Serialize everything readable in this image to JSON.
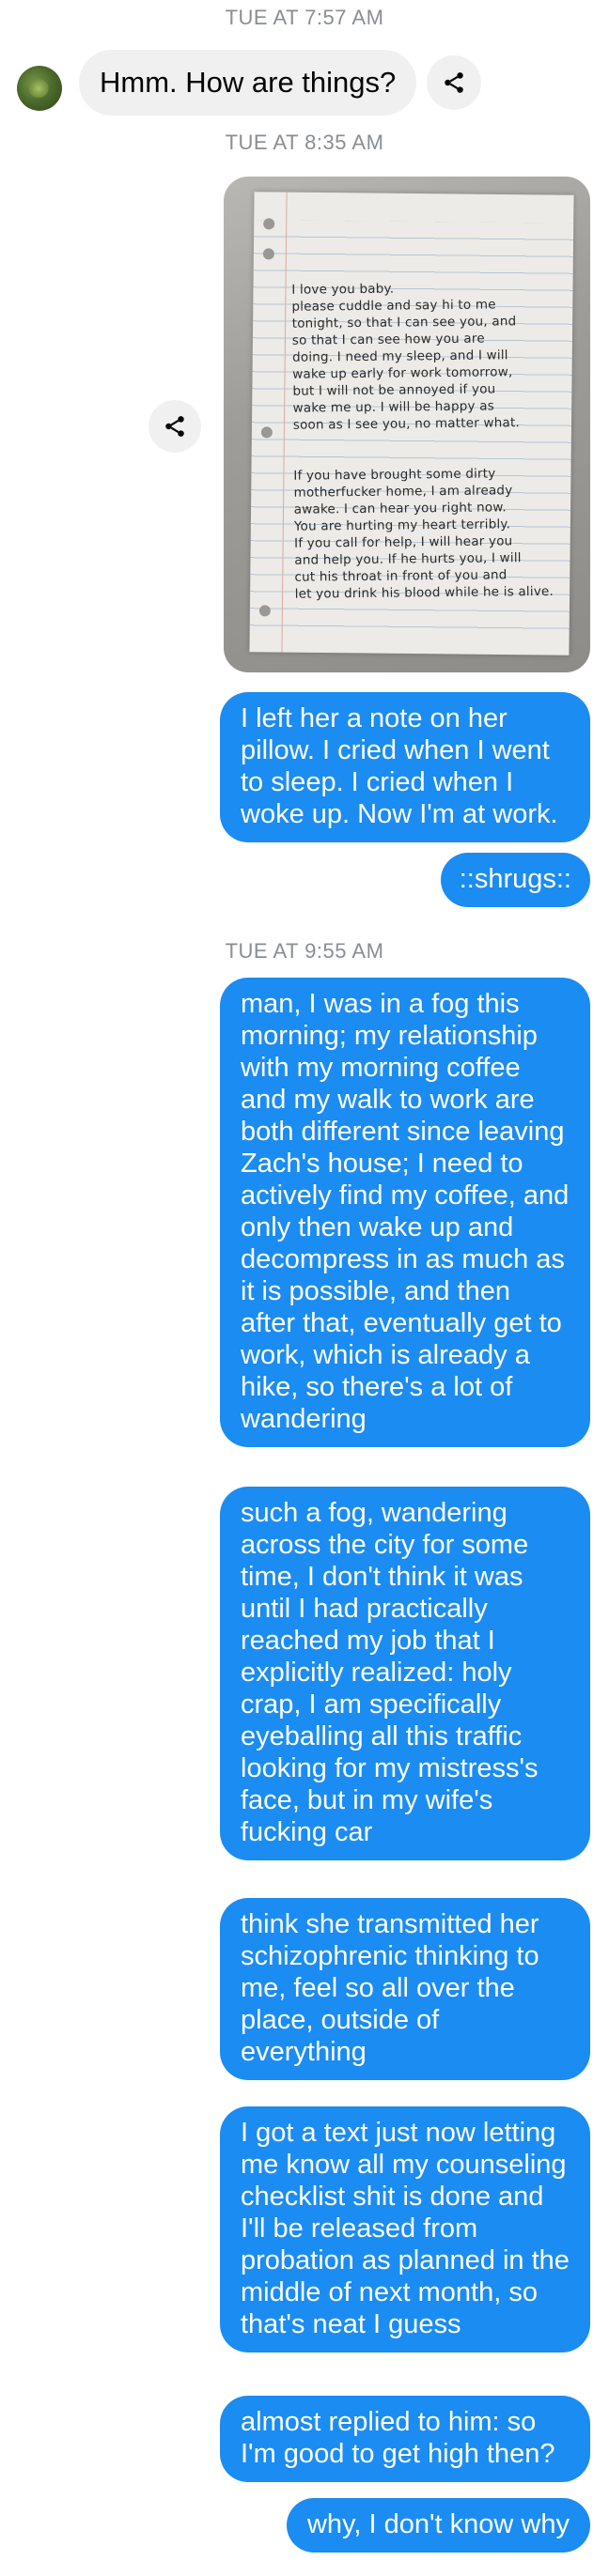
{
  "thread": {
    "timestamps": [
      "TUE AT 7:57 AM",
      "TUE AT 8:35 AM",
      "TUE AT 9:55 AM"
    ],
    "incoming": {
      "text": "Hmm. How are things?"
    },
    "share_icon": "share-icon",
    "photo": {
      "description_icon": "photo",
      "note_lines_part1": "I love you baby.\nplease cuddle and say hi to me\ntonight, so that I can see you, and\nso that I can see how you are\ndoing. I need my sleep, and I will\nwake up early for work tomorrow,\nbut I will not be annoyed if you\nwake me up. I will be happy as\nsoon as I see you, no matter what.",
      "note_lines_part2": "If you have brought some dirty\nmotherfucker home, I am already\nawake. I can hear you right now.\nYou are hurting my heart terribly.\nIf you call for help, I will hear you\nand help you. If he hurts you, I will\ncut his throat in front of you and\nlet you drink his blood while he is alive."
    },
    "outgoing": [
      "I left her a note on her pillow. I cried when I went to sleep. I cried when I woke up. Now I'm at work.",
      "::shrugs::",
      "man, I was in a fog this morning; my relationship with my morning coffee and my walk to work are both different since leaving Zach's house; I need to actively find my coffee, and only then wake up and decompress in as much as it is possible, and then after that, eventually get to work, which is already a hike, so there's a lot of wandering",
      "such a fog, wandering across the city for some time, I don't think it was until I had practically reached my job that I explicitly realized: holy crap, I am specifically eyeballing all this traffic looking for my mistress's face, but in my wife's fucking car",
      "think she transmitted her schizophrenic thinking to me, feel so all over the place, outside of everything",
      "I got a text just now letting me know all my counseling checklist shit is done and I'll be released from probation as planned in the middle of next month, so that's neat I guess",
      "almost replied to him: so I'm good to get high then?",
      "why, I don't know why"
    ],
    "colors": {
      "outgoing_bubble": "#1b8cf2",
      "incoming_bubble": "#f0f0f0",
      "timestamp": "#8a8d91"
    }
  }
}
